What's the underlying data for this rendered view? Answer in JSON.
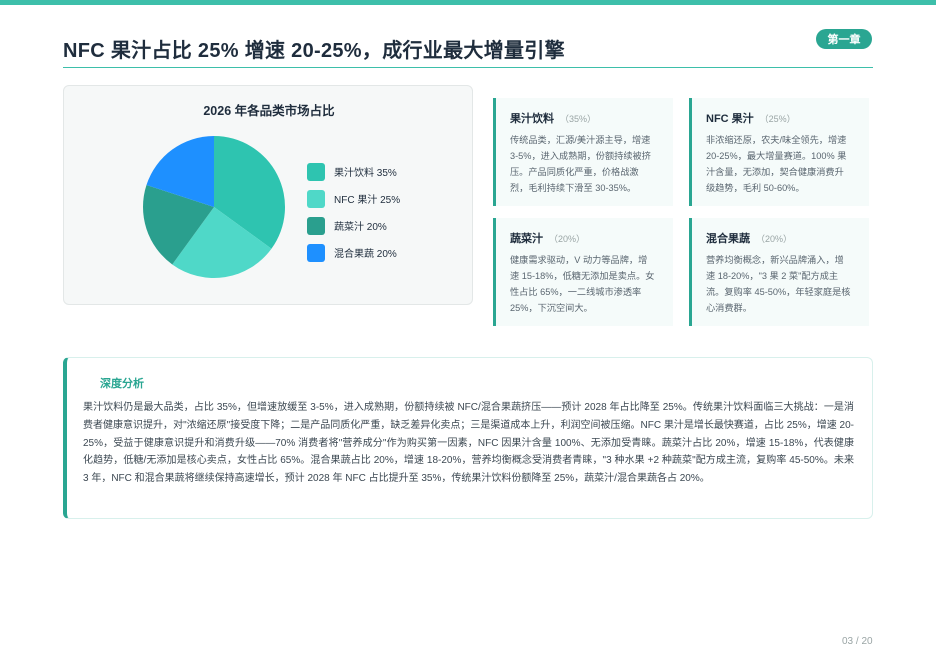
{
  "header": {
    "chapter_badge": "第一章",
    "title": "NFC 果汁占比 25% 增速 20-25%，成行业最大增量引擎"
  },
  "chart_data": {
    "type": "pie",
    "title": "2026 年各品类市场占比",
    "categories": [
      "果汁饮料 35%",
      "NFC 果汁 25%",
      "蔬菜汁 20%",
      "混合果蔬 20%"
    ],
    "values": [
      35,
      25,
      20,
      20
    ],
    "colors": [
      "#2ec4b0",
      "#4fd8c8",
      "#2a9f8e",
      "#1e90ff"
    ],
    "legend": "right"
  },
  "categories": [
    {
      "name": "果汁饮料",
      "share": "（35%）",
      "desc": [
        "传统品类，汇源/美汁源主导，增速",
        "3-5%，进入成熟期，份额持续被挤",
        "压。产品同质化严重，价格战激",
        "烈，毛利持续下滑至 30-35%。"
      ]
    },
    {
      "name": "NFC 果汁",
      "share": "（25%）",
      "desc": [
        "非浓缩还原，农夫/味全领先，增速",
        "20-25%，最大增量赛道。100% 果",
        "汁含量，无添加，契合健康消费升",
        "级趋势，毛利 50-60%。"
      ]
    },
    {
      "name": "蔬菜汁",
      "share": "（20%）",
      "desc": [
        "健康需求驱动，V 动力等品牌，增",
        "速 15-18%，低糖无添加是卖点。女",
        "性占比 65%，一二线城市渗透率",
        "25%，下沉空间大。"
      ]
    },
    {
      "name": "混合果蔬",
      "share": "（20%）",
      "desc": [
        "营养均衡概念，新兴品牌涌入，增",
        "速 18-20%，\"3 果 2 菜\"配方成主",
        "流。复购率 45-50%，年轻家庭是核",
        "心消费群。"
      ]
    }
  ],
  "analysis": {
    "title": "深度分析",
    "body": "果汁饮料仍是最大品类，占比 35%，但增速放缓至 3-5%，进入成熟期，份额持续被 NFC/混合果蔬挤压——预计 2028 年占比降至 25%。传统果汁饮料面临三大挑战：一是消费者健康意识提升，对\"浓缩还原\"接受度下降；二是产品同质化严重，缺乏差异化卖点；三是渠道成本上升，利润空间被压缩。NFC 果汁是增长最快赛道，占比 25%，增速 20-25%，受益于健康意识提升和消费升级——70% 消费者将\"营养成分\"作为购买第一因素，NFC 因果汁含量 100%、无添加受青睐。蔬菜汁占比 20%，增速 15-18%，代表健康化趋势，低糖/无添加是核心卖点，女性占比 65%。混合果蔬占比 20%，增速 18-20%，营养均衡概念受消费者青睐，\"3 种水果 +2 种蔬菜\"配方成主流，复购率 45-50%。未来 3 年，NFC 和混合果蔬将继续保持高速增长，预计 2028 年 NFC 占比提升至 35%，传统果汁饮料份额降至 25%，蔬菜汁/混合果蔬各占 20%。"
  },
  "footer": {
    "page_number": "03 / 20"
  }
}
